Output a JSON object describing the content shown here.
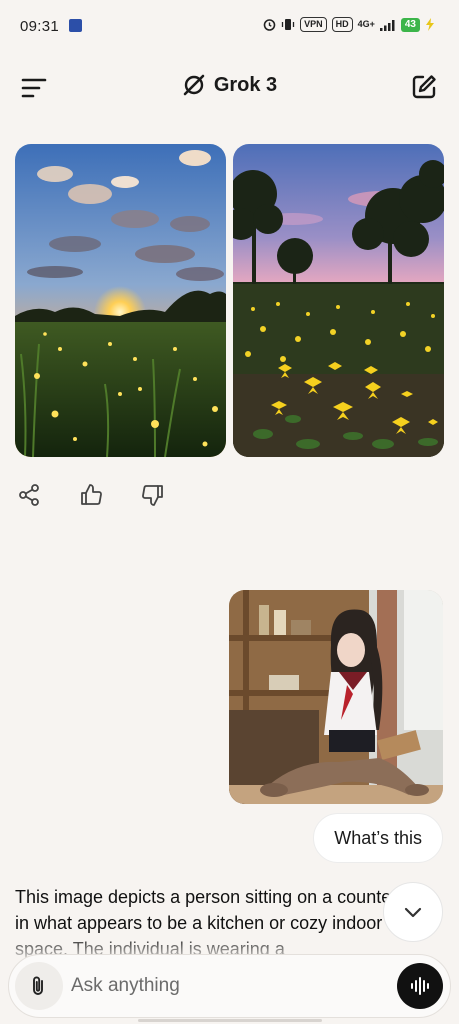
{
  "status_bar": {
    "time": "09:31",
    "vpn_label": "VPN",
    "hd_label": "HD",
    "network_label": "4G+",
    "battery_level": "43"
  },
  "header": {
    "title": "Grok 3",
    "icons": [
      "menu-icon",
      "grok-logo-icon",
      "new-chat-icon"
    ]
  },
  "generated_images": [
    {
      "subject": "sunset meadow with fireflies"
    },
    {
      "subject": "twilight field with yellow flowers and trees"
    }
  ],
  "message_actions": [
    "share-icon",
    "thumbs-up-icon",
    "thumbs-down-icon"
  ],
  "user_message": {
    "text": "What’s this"
  },
  "response": {
    "text": "This image depicts a person sitting on a countertop in what appears to be a kitchen or cozy indoor space. The individual is wearing a"
  },
  "composer": {
    "placeholder": "Ask anything",
    "icons": [
      "paperclip-icon",
      "voice-icon"
    ]
  },
  "colors": {
    "background": "#f7f4f1",
    "accent_dark": "#111111",
    "battery": "#3cb54a"
  }
}
